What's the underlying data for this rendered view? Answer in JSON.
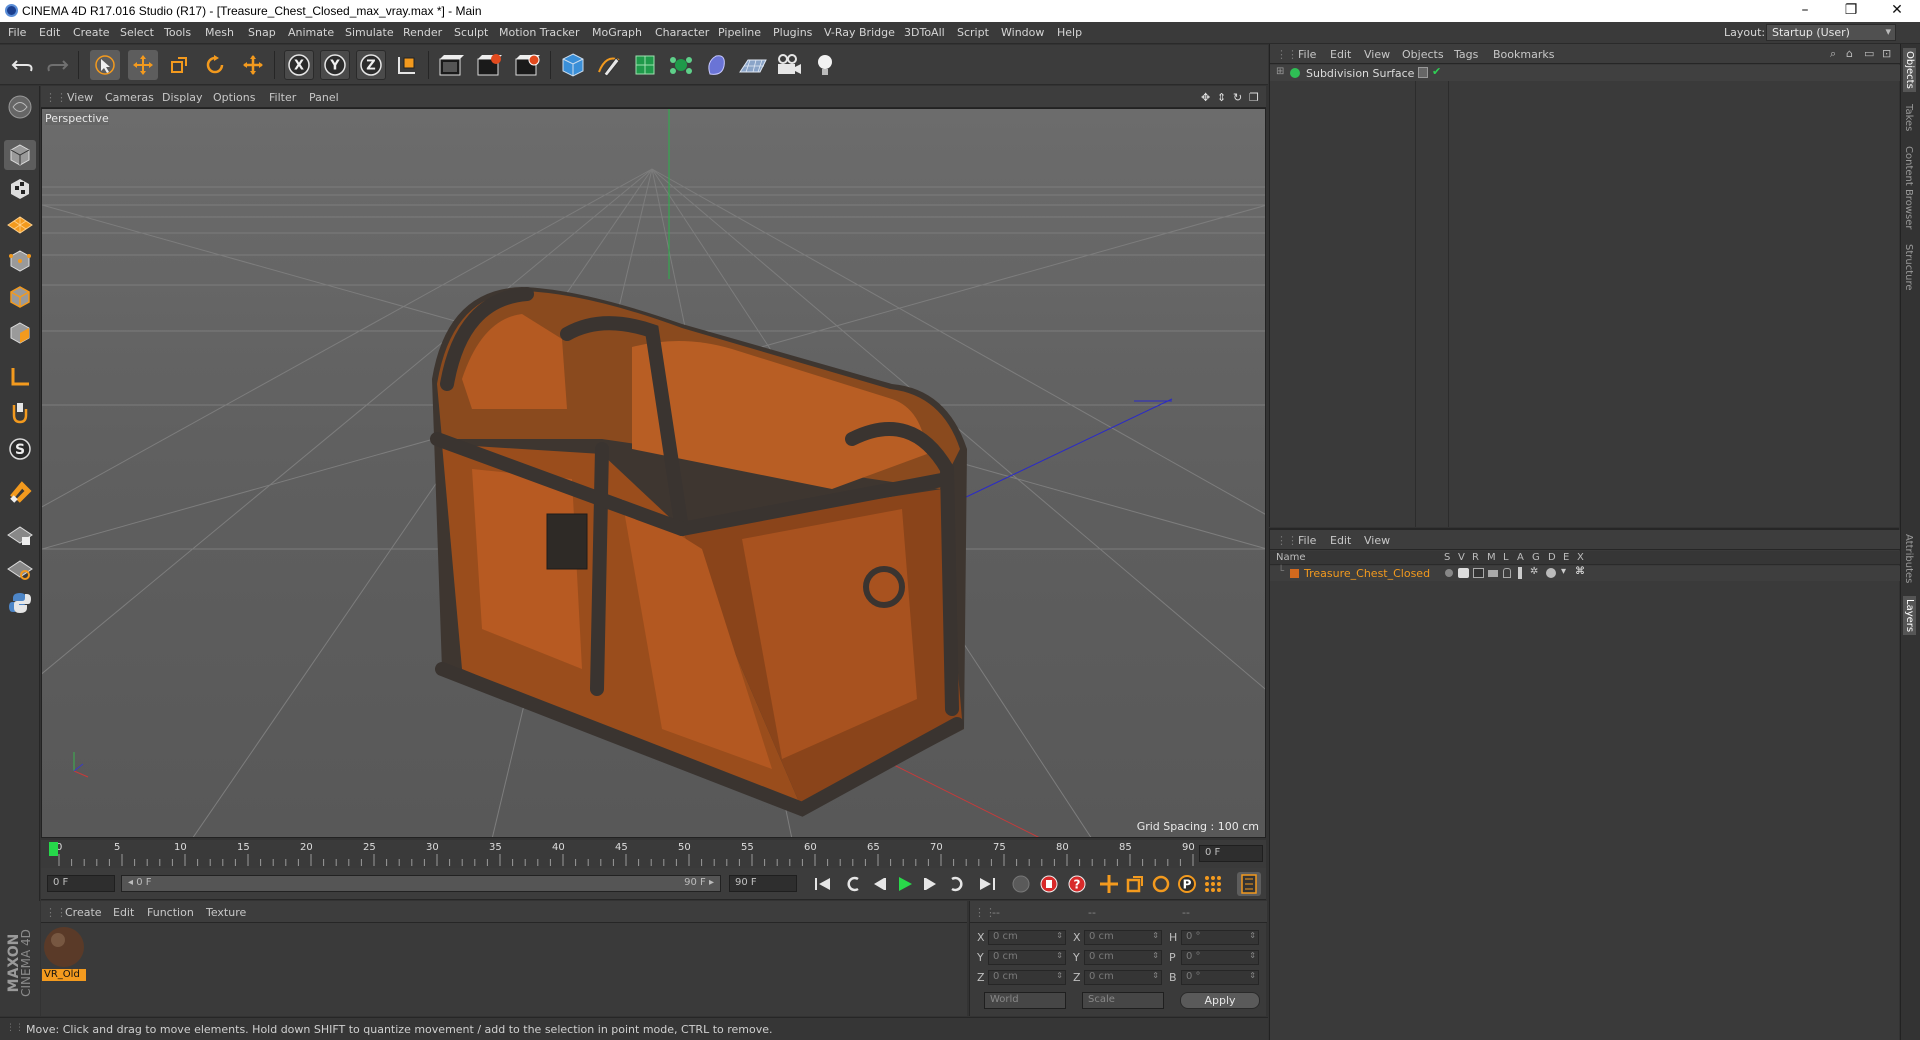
{
  "window": {
    "title": "CINEMA 4D R17.016 Studio (R17) - [Treasure_Chest_Closed_max_vray.max *] - Main",
    "controls": {
      "minimize": "–",
      "restore": "❐",
      "close": "✕"
    }
  },
  "menubar": {
    "items": [
      "File",
      "Edit",
      "Create",
      "Select",
      "Tools",
      "Mesh",
      "Snap",
      "Animate",
      "Simulate",
      "Render",
      "Sculpt",
      "Motion Tracker",
      "MoGraph",
      "Character",
      "Pipeline",
      "Plugins",
      "V-Ray Bridge",
      "3DToAll",
      "Script",
      "Window",
      "Help"
    ],
    "layout_label": "Layout:",
    "layout_value": "Startup (User)"
  },
  "toolbar": {
    "icons": [
      "undo-icon",
      "redo-icon",
      "live-selection-icon",
      "move-icon",
      "scale-icon",
      "rotate-icon",
      "move-last-icon",
      "x-axis-icon",
      "y-axis-icon",
      "z-axis-icon",
      "coordinate-system-icon",
      "render-view-icon",
      "render-picture-viewer-icon",
      "edit-render-settings-icon",
      "cube-icon",
      "pen-icon",
      "subdivision-icon",
      "mograph-icon",
      "deformer-icon",
      "floor-icon",
      "camera-icon",
      "light-icon"
    ],
    "axis_labels": [
      "X",
      "Y",
      "Z"
    ]
  },
  "viewport": {
    "menu": [
      "View",
      "Cameras",
      "Display",
      "Options",
      "Filter",
      "Panel"
    ],
    "label": "Perspective",
    "grid_spacing": "Grid Spacing : 100 cm"
  },
  "timeline": {
    "ticks": [
      "0",
      "5",
      "10",
      "15",
      "20",
      "25",
      "30",
      "35",
      "40",
      "45",
      "50",
      "55",
      "60",
      "65",
      "70",
      "75",
      "80",
      "85",
      "90"
    ],
    "current_frame": "0 F",
    "start_field": "0 F",
    "range_start": "◂ 0 F",
    "range_end": "90 F ▸",
    "end_field": "90 F"
  },
  "material_manager": {
    "menu": [
      "Create",
      "Edit",
      "Function",
      "Texture"
    ],
    "materials": [
      {
        "name": "VR_Old"
      }
    ]
  },
  "coordinates": {
    "header": [
      "--",
      "--",
      "--"
    ],
    "rows": [
      {
        "a": "X",
        "av": "0 cm",
        "b": "X",
        "bv": "0 cm",
        "c": "H",
        "cv": "0 °"
      },
      {
        "a": "Y",
        "av": "0 cm",
        "b": "Y",
        "bv": "0 cm",
        "c": "P",
        "cv": "0 °"
      },
      {
        "a": "Z",
        "av": "0 cm",
        "b": "Z",
        "bv": "0 cm",
        "c": "B",
        "cv": "0 °"
      }
    ],
    "world": "World",
    "scale": "Scale",
    "apply": "Apply"
  },
  "status": "Move: Click and drag to move elements. Hold down SHIFT to quantize movement / add to the selection in point mode, CTRL to remove.",
  "maxon": {
    "brand": "MAXON",
    "product": "CINEMA 4D"
  },
  "object_manager": {
    "menu": [
      "File",
      "Edit",
      "View",
      "Objects",
      "Tags",
      "Bookmarks"
    ],
    "objects": [
      {
        "name": "Subdivision Surface"
      }
    ]
  },
  "layer_manager": {
    "menu": [
      "File",
      "Edit",
      "View"
    ],
    "columns": [
      "Name",
      "S",
      "V",
      "R",
      "M",
      "L",
      "A",
      "G",
      "D",
      "E",
      "X"
    ],
    "layers": [
      {
        "name": "Treasure_Chest_Closed",
        "color": "#d2691e"
      }
    ]
  },
  "side_tabs": [
    "Objects",
    "Takes",
    "Content Browser",
    "Structure",
    "Attributes",
    "Layers"
  ]
}
